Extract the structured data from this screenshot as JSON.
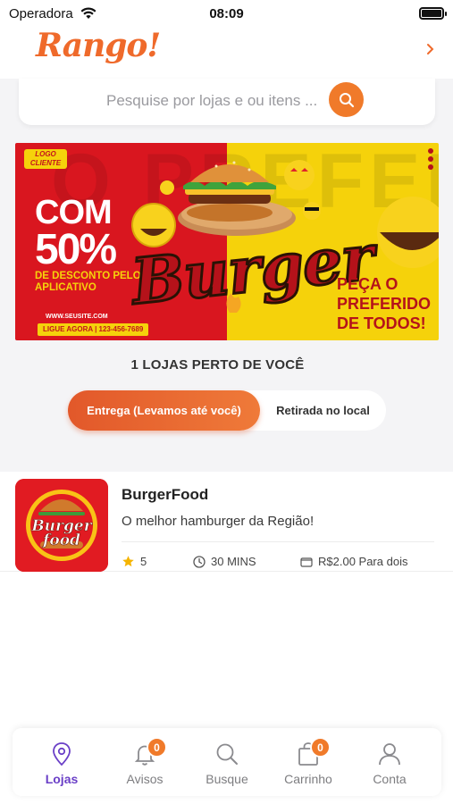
{
  "status_bar": {
    "carrier": "Operadora",
    "time": "08:09"
  },
  "header": {
    "logo_text": "Rango!"
  },
  "search": {
    "placeholder": "Pesquise por lojas e ou itens ..."
  },
  "banner": {
    "logo_badge": "LOGO CLIENTE",
    "bg_text": "O PREFERIDO",
    "headline_1": "COM",
    "headline_2": "50%",
    "subtext": "DE DESCONTO PELO APLICATIVO",
    "site": "WWW.SEUSITE.COM",
    "phone": "LIGUE AGORA | 123-456-7689",
    "brand_word": "Burger",
    "cta": "PEÇA O PREFERIDO DE TODOS!"
  },
  "nearby": {
    "title": "1 LOJAS PERTO DE VOCÊ",
    "toggle_active": "Entrega (Levamos até você)",
    "toggle_inactive": "Retirada no local"
  },
  "store": {
    "logo_text_1": "Burger",
    "logo_text_2": "food",
    "name": "BurgerFood",
    "description": "O melhor hamburger da Região!",
    "rating": "5",
    "time": "30 MINS",
    "price": "R$2.00 Para dois"
  },
  "bottom_nav": {
    "items": [
      {
        "label": "Lojas",
        "icon": "map-pin-icon",
        "active": true
      },
      {
        "label": "Avisos",
        "icon": "bell-icon",
        "badge": "0"
      },
      {
        "label": "Busque",
        "icon": "search-icon"
      },
      {
        "label": "Carrinho",
        "icon": "bag-icon",
        "badge": "0"
      },
      {
        "label": "Conta",
        "icon": "user-icon"
      }
    ]
  },
  "colors": {
    "brand": "#ef6a2b",
    "active_nav": "#6a3fc7",
    "badge": "#f07a2a"
  }
}
